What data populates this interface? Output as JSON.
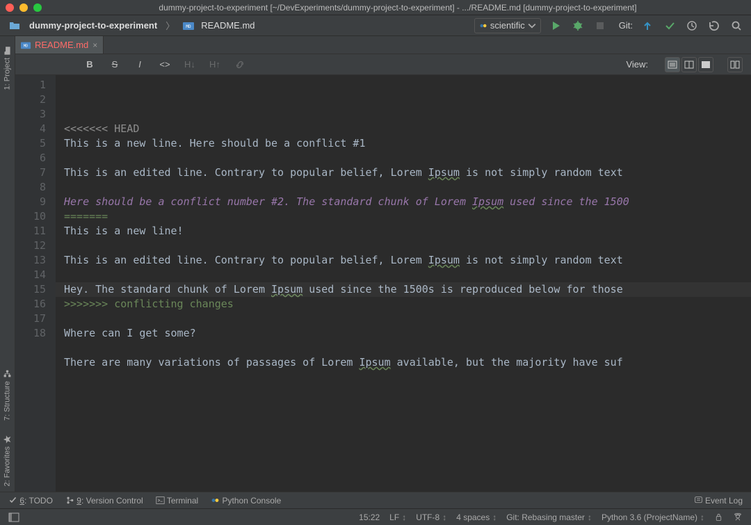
{
  "window": {
    "title": "dummy-project-to-experiment [~/DevExperiments/dummy-project-to-experiment] - .../README.md [dummy-project-to-experiment]"
  },
  "navbar": {
    "breadcrumb_project": "dummy-project-to-experiment",
    "breadcrumb_file": "README.md",
    "run_config": "scientific",
    "git_label": "Git:"
  },
  "left_tabs": {
    "project": "1: Project",
    "structure": "7: Structure",
    "favorites": "2: Favorites"
  },
  "tab": {
    "label": "README.md"
  },
  "md_toolbar": {
    "view_label": "View:"
  },
  "gutter_lines": [
    "1",
    "2",
    "3",
    "4",
    "5",
    "6",
    "7",
    "8",
    "9",
    "10",
    "11",
    "12",
    "13",
    "14",
    "15",
    "16",
    "17",
    "18"
  ],
  "code_lines": [
    {
      "text": "<<<<<<< HEAD",
      "cls": "cl1"
    },
    {
      "text": "This is a new line. Here should be a conflict #1"
    },
    {
      "text": ""
    },
    {
      "text": "This is an edited line. Contrary to popular belief, Lorem Ipsum is not simply random text",
      "und": [
        "Ipsum"
      ]
    },
    {
      "text": ""
    },
    {
      "text": "Here should be a conflict number #2. The standard chunk of Lorem Ipsum used since the 1500",
      "cls": "purple",
      "und": [
        "Ipsum"
      ]
    },
    {
      "text": "=======",
      "cls": "green"
    },
    {
      "text": "This is a new line!"
    },
    {
      "text": ""
    },
    {
      "text": "This is an edited line. Contrary to popular belief, Lorem Ipsum is not simply random text",
      "und": [
        "Ipsum"
      ]
    },
    {
      "text": ""
    },
    {
      "text": "Hey. The standard chunk of Lorem Ipsum used since the 1500s is reproduced below for those",
      "und": [
        "Ipsum"
      ]
    },
    {
      "text": ">>>>>>> conflicting changes",
      "cls": "green"
    },
    {
      "text": ""
    },
    {
      "text": "Where can I get some?"
    },
    {
      "text": ""
    },
    {
      "text": "There are many variations of passages of Lorem Ipsum available, but the majority have suf",
      "und": [
        "Ipsum"
      ]
    },
    {
      "text": ""
    }
  ],
  "current_line_index": 14,
  "conflict_segments": [
    {
      "start": 0,
      "end": 6,
      "color": "#6a8759"
    },
    {
      "start": 6,
      "end": 13,
      "color": "#6a8759"
    }
  ],
  "bottom_tools": {
    "todo": "6: TODO",
    "vcs": "9: Version Control",
    "terminal": "Terminal",
    "pyconsole": "Python Console",
    "eventlog": "Event Log"
  },
  "statusbar": {
    "position": "15:22",
    "line_ending": "LF",
    "encoding": "UTF-8",
    "indent": "4 spaces",
    "git": "Git: Rebasing master",
    "interpreter": "Python 3.6 (ProjectName)"
  }
}
